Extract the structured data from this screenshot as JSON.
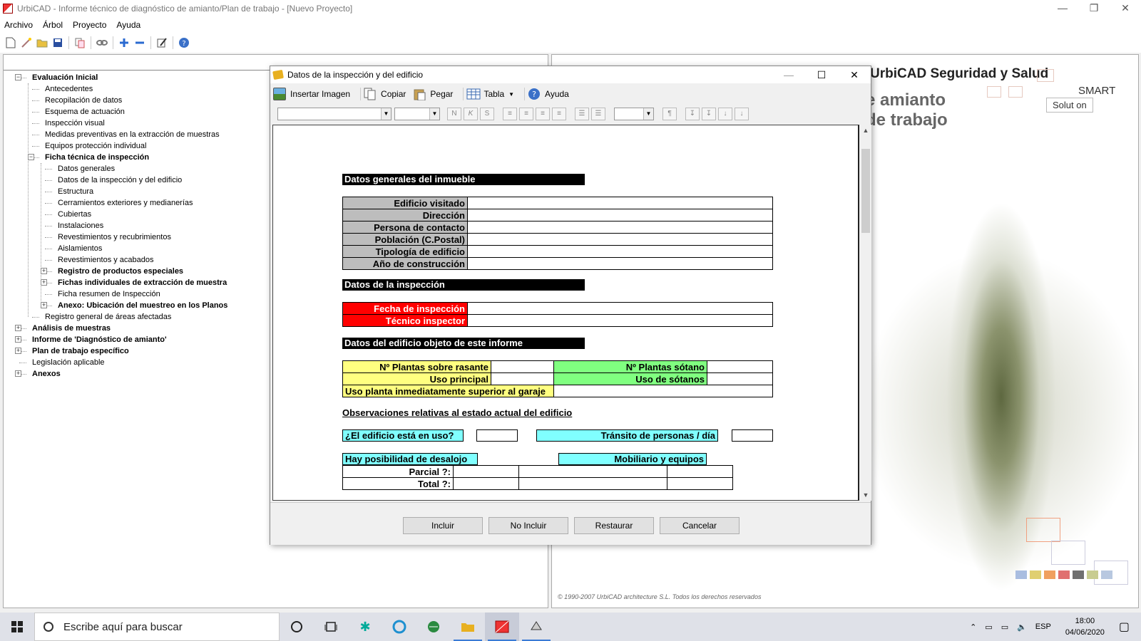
{
  "window": {
    "title": "UrbiCAD - Informe técnico de diagnóstico de amianto/Plan de trabajo  - [Nuevo Proyecto]",
    "controls": [
      "—",
      "❐",
      "✕"
    ]
  },
  "menu": [
    "Archivo",
    "Árbol",
    "Proyecto",
    "Ayuda"
  ],
  "tree": [
    {
      "label": "Evaluación Inicial",
      "level": 0,
      "bold": true,
      "expander": "−"
    },
    {
      "label": "Antecedentes",
      "level": 1,
      "bold": false
    },
    {
      "label": "Recopilación de datos",
      "level": 1,
      "bold": false
    },
    {
      "label": "Esquema de actuación",
      "level": 1,
      "bold": false
    },
    {
      "label": "Inspección visual",
      "level": 1,
      "bold": false
    },
    {
      "label": "Medidas preventivas en la extracción de muestras",
      "level": 1,
      "bold": false
    },
    {
      "label": "Equipos protección individual",
      "level": 1,
      "bold": false
    },
    {
      "label": "Ficha técnica de inspección",
      "level": 1,
      "bold": true,
      "expander": "−"
    },
    {
      "label": "Datos generales",
      "level": 2,
      "bold": false
    },
    {
      "label": "Datos de la inspección y del edificio",
      "level": 2,
      "bold": false
    },
    {
      "label": "Estructura",
      "level": 2,
      "bold": false
    },
    {
      "label": "Cerramientos exteriores y medianerías",
      "level": 2,
      "bold": false
    },
    {
      "label": "Cubiertas",
      "level": 2,
      "bold": false
    },
    {
      "label": "Instalaciones",
      "level": 2,
      "bold": false
    },
    {
      "label": "Revestimientos y recubrimientos",
      "level": 2,
      "bold": false
    },
    {
      "label": "Aislamientos",
      "level": 2,
      "bold": false
    },
    {
      "label": "Revestimientos y acabados",
      "level": 2,
      "bold": false
    },
    {
      "label": "Registro de productos especiales",
      "level": 2,
      "bold": true,
      "expander": "+"
    },
    {
      "label": "Fichas individuales de extracción de muestra",
      "level": 2,
      "bold": true,
      "expander": "+"
    },
    {
      "label": "Ficha resumen de Inspección",
      "level": 2,
      "bold": false
    },
    {
      "label": "Anexo: Ubicación del muestreo en los Planos",
      "level": 2,
      "bold": true,
      "expander": "+"
    },
    {
      "label": "Registro general de áreas afectadas",
      "level": 1,
      "bold": false
    },
    {
      "label": "Análisis de muestras",
      "level": 0,
      "bold": true,
      "expander": "+"
    },
    {
      "label": "Informe de 'Diagnóstico de amianto'",
      "level": 0,
      "bold": true,
      "expander": "+"
    },
    {
      "label": "Plan de trabajo específico",
      "level": 0,
      "bold": true,
      "expander": "+"
    },
    {
      "label": "Legislación aplicable",
      "level": 0,
      "bold": false
    },
    {
      "label": "Anexos",
      "level": 0,
      "bold": true,
      "expander": "+"
    }
  ],
  "splash": {
    "brand": "UrbiCAD Seguridad y Salud",
    "line1": "e amianto",
    "line2": "de trabajo",
    "smart": "SMART",
    "solution": "Solut on",
    "copyright": "© 1990-2007 UrbiCAD architecture S.L. Todos los derechos reservados"
  },
  "dialog": {
    "title": "Datos de la inspección y del edificio",
    "controls": [
      "—",
      "☐",
      "✕"
    ],
    "toolbar": {
      "insert_image": "Insertar Imagen",
      "copy": "Copiar",
      "paste": "Pegar",
      "table": "Tabla",
      "help": "Ayuda"
    },
    "format_buttons": [
      "N",
      "K",
      "S",
      "≡",
      "≡",
      "≡",
      "≡",
      "☰",
      "☰",
      "¶",
      "↧",
      "↧",
      "↓",
      "↓"
    ],
    "document": {
      "section1": "Datos generales del inmueble",
      "general_rows": [
        "Edificio visitado",
        "Dirección",
        "Persona de contacto",
        "Población (C.Postal)",
        "Tipología de edificio",
        "Año de construcción"
      ],
      "section2": "Datos de la inspección",
      "inspection_rows": [
        "Fecha de inspección",
        "Técnico inspector"
      ],
      "section3": "Datos del edificio objeto de este informe",
      "plantas_sobre": "Nº Plantas sobre rasante",
      "plantas_sotano": "Nº Plantas sótano",
      "uso_principal": "Uso principal",
      "uso_sotanos": "Uso de sótanos",
      "uso_planta_sup": "Uso planta inmediatamente superior al garaje",
      "observaciones": "Observaciones relativas al estado actual del edificio",
      "en_uso": "¿El edificio está en uso?",
      "transito": "Tránsito de personas / día",
      "desalojo": "Hay posibilidad de desalojo",
      "mobiliario": "Mobiliario y equipos",
      "parcial": "Parcial ?:",
      "total": "Total ?:"
    },
    "buttons": {
      "incluir": "Incluir",
      "no_incluir": "No Incluir",
      "restaurar": "Restaurar",
      "cancelar": "Cancelar"
    }
  },
  "taskbar": {
    "search_placeholder": "Escribe aquí para buscar",
    "lang": "ESP",
    "time": "18:00",
    "date": "04/06/2020"
  },
  "colors": {
    "gray_label": "#bdbdbd",
    "red_label": "#ff0000",
    "yellow_label": "#ffff80",
    "green_label": "#80ff80",
    "cyan_label": "#80ffff"
  }
}
